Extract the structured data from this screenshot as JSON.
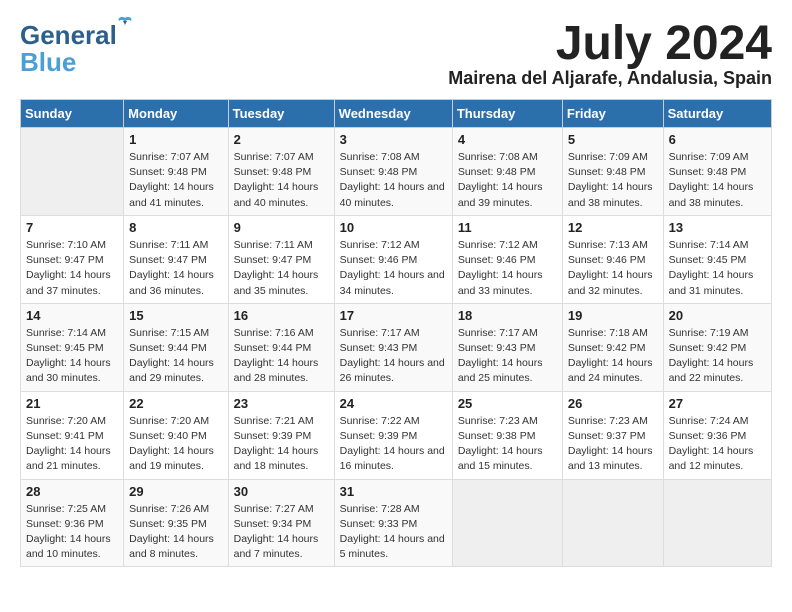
{
  "logo": {
    "line1": "General",
    "line2": "Blue"
  },
  "title": "July 2024",
  "location": "Mairena del Aljarafe, Andalusia, Spain",
  "weekdays": [
    "Sunday",
    "Monday",
    "Tuesday",
    "Wednesday",
    "Thursday",
    "Friday",
    "Saturday"
  ],
  "weeks": [
    [
      {
        "day": "",
        "sunrise": "",
        "sunset": "",
        "daylight": ""
      },
      {
        "day": "1",
        "sunrise": "7:07 AM",
        "sunset": "9:48 PM",
        "daylight": "14 hours and 41 minutes."
      },
      {
        "day": "2",
        "sunrise": "7:07 AM",
        "sunset": "9:48 PM",
        "daylight": "14 hours and 40 minutes."
      },
      {
        "day": "3",
        "sunrise": "7:08 AM",
        "sunset": "9:48 PM",
        "daylight": "14 hours and 40 minutes."
      },
      {
        "day": "4",
        "sunrise": "7:08 AM",
        "sunset": "9:48 PM",
        "daylight": "14 hours and 39 minutes."
      },
      {
        "day": "5",
        "sunrise": "7:09 AM",
        "sunset": "9:48 PM",
        "daylight": "14 hours and 38 minutes."
      },
      {
        "day": "6",
        "sunrise": "7:09 AM",
        "sunset": "9:48 PM",
        "daylight": "14 hours and 38 minutes."
      }
    ],
    [
      {
        "day": "7",
        "sunrise": "7:10 AM",
        "sunset": "9:47 PM",
        "daylight": "14 hours and 37 minutes."
      },
      {
        "day": "8",
        "sunrise": "7:11 AM",
        "sunset": "9:47 PM",
        "daylight": "14 hours and 36 minutes."
      },
      {
        "day": "9",
        "sunrise": "7:11 AM",
        "sunset": "9:47 PM",
        "daylight": "14 hours and 35 minutes."
      },
      {
        "day": "10",
        "sunrise": "7:12 AM",
        "sunset": "9:46 PM",
        "daylight": "14 hours and 34 minutes."
      },
      {
        "day": "11",
        "sunrise": "7:12 AM",
        "sunset": "9:46 PM",
        "daylight": "14 hours and 33 minutes."
      },
      {
        "day": "12",
        "sunrise": "7:13 AM",
        "sunset": "9:46 PM",
        "daylight": "14 hours and 32 minutes."
      },
      {
        "day": "13",
        "sunrise": "7:14 AM",
        "sunset": "9:45 PM",
        "daylight": "14 hours and 31 minutes."
      }
    ],
    [
      {
        "day": "14",
        "sunrise": "7:14 AM",
        "sunset": "9:45 PM",
        "daylight": "14 hours and 30 minutes."
      },
      {
        "day": "15",
        "sunrise": "7:15 AM",
        "sunset": "9:44 PM",
        "daylight": "14 hours and 29 minutes."
      },
      {
        "day": "16",
        "sunrise": "7:16 AM",
        "sunset": "9:44 PM",
        "daylight": "14 hours and 28 minutes."
      },
      {
        "day": "17",
        "sunrise": "7:17 AM",
        "sunset": "9:43 PM",
        "daylight": "14 hours and 26 minutes."
      },
      {
        "day": "18",
        "sunrise": "7:17 AM",
        "sunset": "9:43 PM",
        "daylight": "14 hours and 25 minutes."
      },
      {
        "day": "19",
        "sunrise": "7:18 AM",
        "sunset": "9:42 PM",
        "daylight": "14 hours and 24 minutes."
      },
      {
        "day": "20",
        "sunrise": "7:19 AM",
        "sunset": "9:42 PM",
        "daylight": "14 hours and 22 minutes."
      }
    ],
    [
      {
        "day": "21",
        "sunrise": "7:20 AM",
        "sunset": "9:41 PM",
        "daylight": "14 hours and 21 minutes."
      },
      {
        "day": "22",
        "sunrise": "7:20 AM",
        "sunset": "9:40 PM",
        "daylight": "14 hours and 19 minutes."
      },
      {
        "day": "23",
        "sunrise": "7:21 AM",
        "sunset": "9:39 PM",
        "daylight": "14 hours and 18 minutes."
      },
      {
        "day": "24",
        "sunrise": "7:22 AM",
        "sunset": "9:39 PM",
        "daylight": "14 hours and 16 minutes."
      },
      {
        "day": "25",
        "sunrise": "7:23 AM",
        "sunset": "9:38 PM",
        "daylight": "14 hours and 15 minutes."
      },
      {
        "day": "26",
        "sunrise": "7:23 AM",
        "sunset": "9:37 PM",
        "daylight": "14 hours and 13 minutes."
      },
      {
        "day": "27",
        "sunrise": "7:24 AM",
        "sunset": "9:36 PM",
        "daylight": "14 hours and 12 minutes."
      }
    ],
    [
      {
        "day": "28",
        "sunrise": "7:25 AM",
        "sunset": "9:36 PM",
        "daylight": "14 hours and 10 minutes."
      },
      {
        "day": "29",
        "sunrise": "7:26 AM",
        "sunset": "9:35 PM",
        "daylight": "14 hours and 8 minutes."
      },
      {
        "day": "30",
        "sunrise": "7:27 AM",
        "sunset": "9:34 PM",
        "daylight": "14 hours and 7 minutes."
      },
      {
        "day": "31",
        "sunrise": "7:28 AM",
        "sunset": "9:33 PM",
        "daylight": "14 hours and 5 minutes."
      },
      {
        "day": "",
        "sunrise": "",
        "sunset": "",
        "daylight": ""
      },
      {
        "day": "",
        "sunrise": "",
        "sunset": "",
        "daylight": ""
      },
      {
        "day": "",
        "sunrise": "",
        "sunset": "",
        "daylight": ""
      }
    ]
  ],
  "labels": {
    "sunrise_prefix": "Sunrise: ",
    "sunset_prefix": "Sunset: ",
    "daylight_prefix": "Daylight: "
  }
}
